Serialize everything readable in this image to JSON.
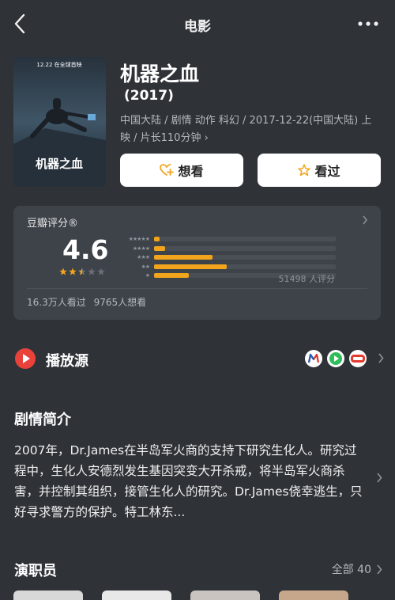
{
  "header": {
    "title": "电影"
  },
  "movie": {
    "title": "机器之血",
    "year": "(2017)",
    "info": "中国大陆 / 剧情 动作 科幻 / 2017-12-22(中国大陆) 上映 / 片长110分钟 ›",
    "poster_text": "机器之血",
    "poster_date": "12.22 在全球首映"
  },
  "actions": {
    "want_label": "想看",
    "seen_label": "看过"
  },
  "rating": {
    "label": "豆瓣评分®",
    "score": "4.6",
    "stars_value": 2.5,
    "distribution": [
      {
        "stars": "★★★★★",
        "fraction": 0.03
      },
      {
        "stars": "★★★★",
        "fraction": 0.06
      },
      {
        "stars": "★★★",
        "fraction": 0.32
      },
      {
        "stars": "★★",
        "fraction": 0.4
      },
      {
        "stars": "★",
        "fraction": 0.19
      }
    ],
    "count": "51498 人评分",
    "watched": "16.3万人看过",
    "wish": "9765人想看"
  },
  "play": {
    "label": "播放源",
    "sources": [
      "mango-tv-icon",
      "iqiyi-icon",
      "youku-icon"
    ]
  },
  "synopsis": {
    "title": "剧情简介",
    "text": "2007年，Dr.James在半岛军火商的支持下研究生化人。研究过程中，生化人安德烈发生基因突变大开杀戒，将半岛军火商杀害，并控制其组织，接管生化人的研究。Dr.James侥幸逃生，只好寻求警方的保护。特工林东..."
  },
  "cast": {
    "title": "演职员",
    "all_label": "全部 40"
  },
  "colors": {
    "background": "#2f3338",
    "card": "#3e434a",
    "accent": "#f2a51c",
    "play_red": "#e8423b"
  }
}
